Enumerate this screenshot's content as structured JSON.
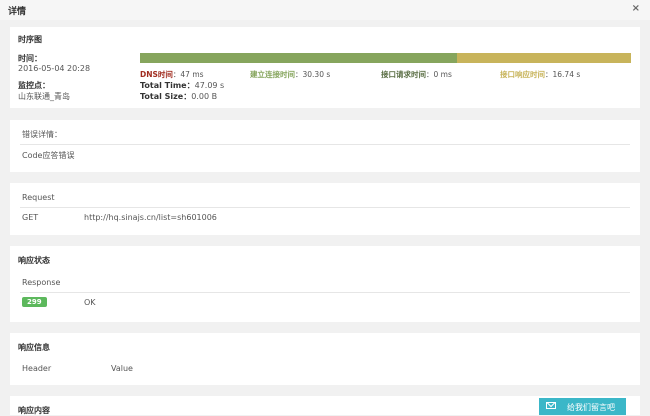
{
  "dialog": {
    "title": "详情",
    "close": "×"
  },
  "timing": {
    "header": "时序图",
    "time_label": "时间：",
    "time_value": "2016-05-04 20:28",
    "monitor_label": "监控点：",
    "monitor_value": "山东联通_青岛",
    "segments": [
      {
        "name": "DNS时间",
        "value": "47 ms",
        "color": "#a02b1e"
      },
      {
        "name": "建立连接时间",
        "value": "30.30 s",
        "color": "#86a55d"
      },
      {
        "name": "接口请求时间",
        "value": "0 ms",
        "color": "#5a6e44"
      },
      {
        "name": "接口响应时间",
        "value": "16.74 s",
        "color": "#c8b45b"
      }
    ],
    "total_time_label": "Total Time：",
    "total_time_value": "47.09 s",
    "total_size_label": "Total Size：",
    "total_size_value": "0.00 B"
  },
  "error": {
    "label": "错误详情：",
    "value": "Code应答错误"
  },
  "request": {
    "header": "Request",
    "method": "GET",
    "url": "http://hq.sinajs.cn/list=sh601006"
  },
  "response_status": {
    "header": "响应状态",
    "sub": "Response",
    "code": "299",
    "text": "OK"
  },
  "response_info": {
    "header": "响应信息",
    "col_header": "Header",
    "col_value": "Value"
  },
  "response_body": {
    "header": "响应内容"
  },
  "feedback_button": {
    "label": "给我们留言吧",
    "color": "#3bb7c8"
  }
}
